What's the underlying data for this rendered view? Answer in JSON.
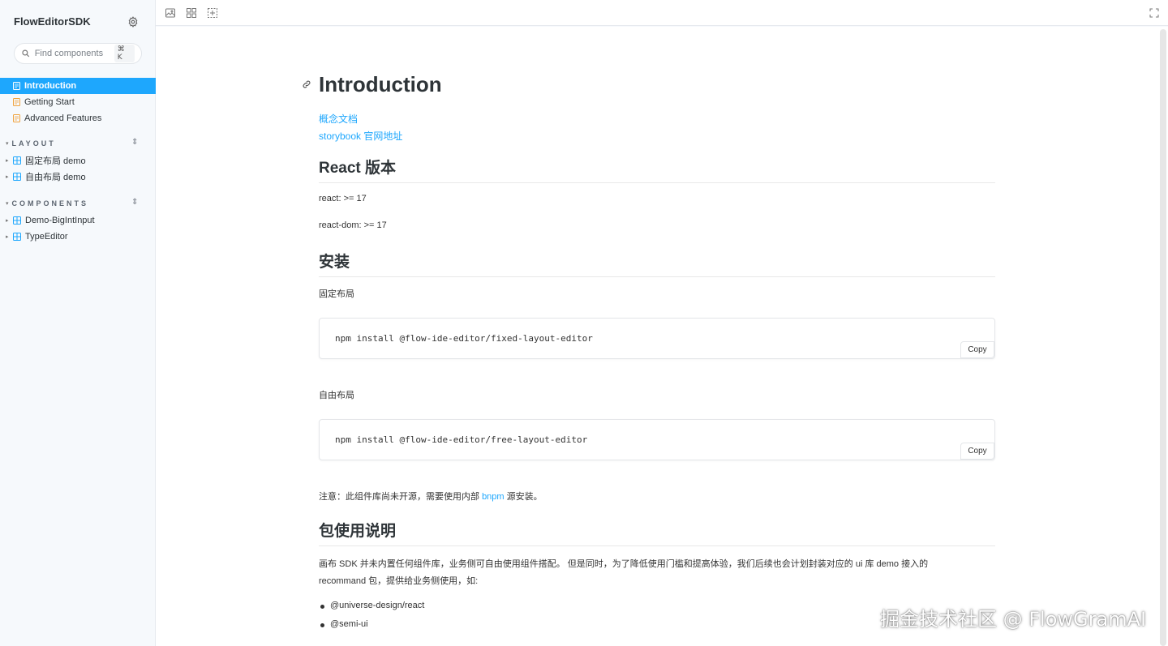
{
  "sidebar": {
    "brand": "FlowEditorSDK",
    "search": {
      "placeholder": "Find components",
      "shortcut": "⌘ K"
    },
    "docs": [
      {
        "label": "Introduction",
        "active": true
      },
      {
        "label": "Getting Start",
        "active": false
      },
      {
        "label": "Advanced Features",
        "active": false
      }
    ],
    "groups": [
      {
        "title": "LAYOUT",
        "items": [
          "固定布局 demo",
          "自由布局 demo"
        ]
      },
      {
        "title": "COMPONENTS",
        "items": [
          "Demo-BigIntInput",
          "TypeEditor"
        ]
      }
    ],
    "icons": {
      "settings": "gear-icon",
      "search": "search-icon",
      "doc": "document-icon",
      "component": "component-grid-icon"
    }
  },
  "toolbar": {
    "icons": [
      "image-icon",
      "grid-icon",
      "outline-icon",
      "fullscreen-icon"
    ]
  },
  "doc": {
    "title": "Introduction",
    "links": [
      "概念文档",
      "storybook 官网地址"
    ],
    "react_heading": "React 版本",
    "react_req": "react: >= 17",
    "react_dom_req": "react-dom: >= 17",
    "install_heading": "安装",
    "fixed_label": "固定布局",
    "fixed_cmd": "npm install @flow-ide-editor/fixed-layout-editor",
    "free_label": "自由布局",
    "free_cmd": "npm install @flow-ide-editor/free-layout-editor",
    "copy_label": "Copy",
    "note_prefix": "注意：此组件库尚未开源，需要使用内部 ",
    "note_link": "bnpm",
    "note_suffix": " 源安装。",
    "usage_heading": "包使用说明",
    "usage_line1": "画布 SDK 并未内置任何组件库，业务侧可自由使用组件搭配。 但是同时，为了降低使用门槛和提高体验，我们后续也会计划封装对应的 ui 库 demo 接入的",
    "usage_line2": "recommand 包，提供给业务侧使用，如:",
    "packages": [
      "@universe-design/react",
      "@semi-ui"
    ]
  },
  "watermark": "掘金技术社区 @ FlowGramAI",
  "colors": {
    "accent": "#1ea7fd",
    "sidebar_bg": "#f6f9fc",
    "text": "#2e3438"
  }
}
